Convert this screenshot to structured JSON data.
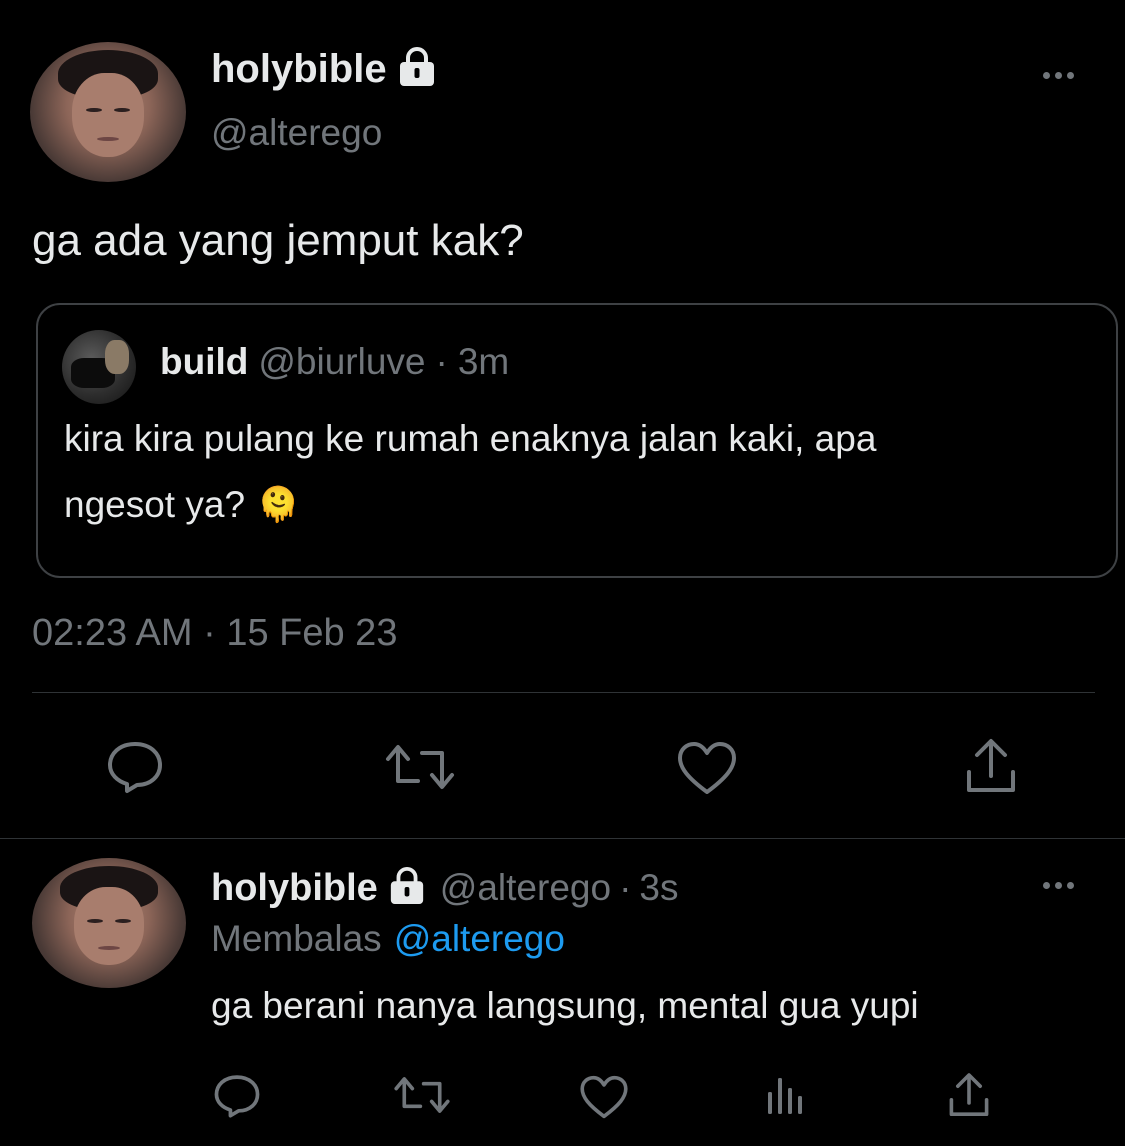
{
  "main_tweet": {
    "display_name": "holybible",
    "handle": "@alterego",
    "text": "ga ada yang jemput kak?",
    "timestamp": "02:23 AM · 15 Feb 23",
    "quoted": {
      "display_name": "build",
      "handle": "@biurluve",
      "separator": "·",
      "time": "3m",
      "text_line1": "kira kira pulang ke rumah enaknya jalan kaki, apa",
      "text_line2": "ngesot ya?",
      "emoji": "🫠"
    }
  },
  "reply": {
    "display_name": "holybible",
    "handle": "@alterego",
    "separator": "·",
    "time": "3s",
    "replying_prefix": "Membalas",
    "replying_to": "@alterego",
    "text": "ga berani nanya langsung, mental gua yupi"
  },
  "icons": {
    "lock": "lock-icon",
    "more": "more-icon",
    "reply": "reply-icon",
    "retweet": "retweet-icon",
    "like": "heart-icon",
    "share": "share-icon",
    "analytics": "analytics-icon"
  },
  "colors": {
    "background": "#000000",
    "text": "#e7e9ea",
    "muted": "#71767b",
    "link": "#1d9bf0",
    "border": "#2f3336"
  }
}
